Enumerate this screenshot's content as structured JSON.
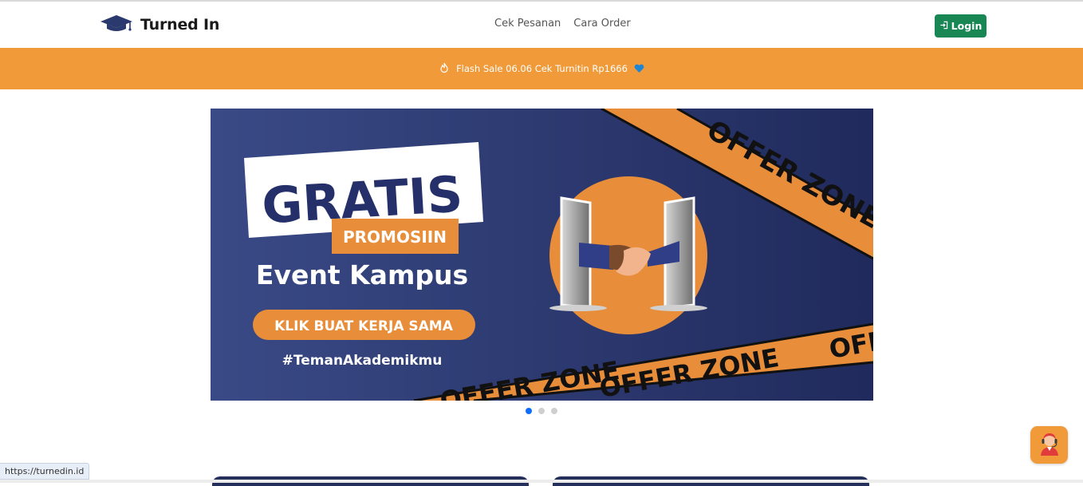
{
  "brand": {
    "name": "Turned In",
    "logo_icon": "graduation-cap-icon"
  },
  "nav": {
    "links": [
      "Cek Pesanan",
      "Cara Order"
    ],
    "login_label": "Login",
    "login_icon": "login-icon"
  },
  "announcement": {
    "text": "Flash Sale 06.06 Cek Turnitin Rp1666",
    "leading_icon": "fire-icon",
    "trailing_icon": "blue-heart-icon"
  },
  "hero_slide": {
    "headline": "GRATIS",
    "subheadline": "PROMOSIIN",
    "title": "Event Kampus",
    "cta": "KLIK BUAT KERJA SAMA",
    "hashtag": "#TemanAkademikmu",
    "tape_text": "OFFER ZONE",
    "slide_count": 3,
    "active_index": 0
  },
  "status_url": "https://turnedin.id",
  "support_button_icon": "customer-service-icon",
  "colors": {
    "accent": "#f09a3a",
    "navy": "#2b3a6e",
    "login_green": "#198754",
    "active_dot": "#0d6efd"
  }
}
